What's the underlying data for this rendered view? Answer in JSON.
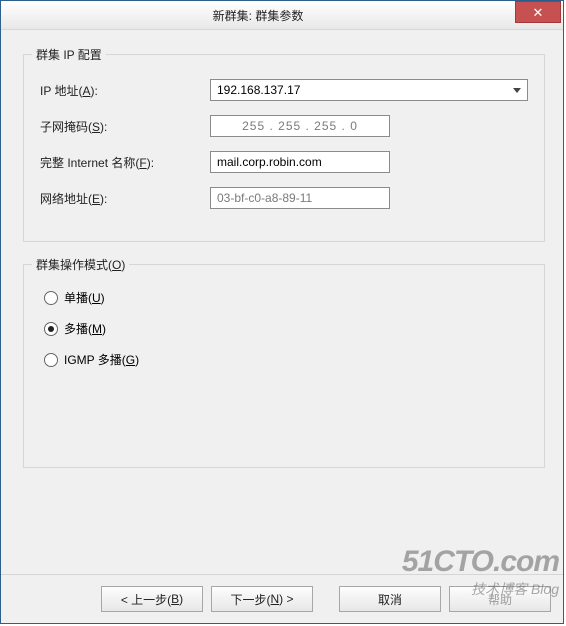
{
  "window": {
    "title": "新群集: 群集参数"
  },
  "group_ip": {
    "legend": "群集 IP 配置",
    "ip_label": "IP 地址(A):",
    "ip_value": "192.168.137.17",
    "subnet_label": "子网掩码(S):",
    "subnet_value": "255 . 255 . 255 .  0",
    "fqdn_label": "完整 Internet 名称(F):",
    "fqdn_value": "mail.corp.robin.com",
    "netaddr_label": "网络地址(E):",
    "netaddr_value": "03-bf-c0-a8-89-11"
  },
  "group_mode": {
    "legend": "群集操作模式(O)",
    "options": {
      "unicast": "单播(U)",
      "multicast": "多播(M)",
      "igmp": "IGMP 多播(G)"
    },
    "selected": "multicast"
  },
  "buttons": {
    "back": "< 上一步(B)",
    "next": "下一步(N) >",
    "cancel": "取消",
    "help": "帮助"
  },
  "watermark": {
    "line1": "51CTO.com",
    "line2": "技术博客 Blog"
  }
}
